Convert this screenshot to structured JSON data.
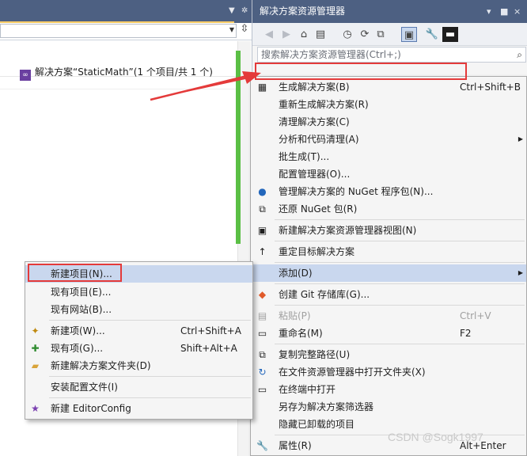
{
  "solution_explorer": {
    "title": "解决方案资源管理器",
    "title_controls": [
      "▾",
      "■",
      "×"
    ],
    "search_placeholder": "搜索解决方案资源管理器(Ctrl+;)",
    "root_node": "解决方案“StaticMath”(1 个项目/共 1 个)"
  },
  "context_menu": {
    "items": [
      {
        "label": "生成解决方案(B)",
        "shortcut": "Ctrl+Shift+B",
        "icon": "build-icon"
      },
      {
        "label": "重新生成解决方案(R)",
        "shortcut": ""
      },
      {
        "label": "清理解决方案(C)",
        "shortcut": ""
      },
      {
        "label": "分析和代码清理(A)",
        "shortcut": "",
        "submenu": true
      },
      {
        "label": "批生成(T)...",
        "shortcut": ""
      },
      {
        "label": "配置管理器(O)...",
        "shortcut": ""
      },
      {
        "label": "管理解决方案的 NuGet 程序包(N)...",
        "shortcut": "",
        "icon": "nuget-icon"
      },
      {
        "label": "还原 NuGet 包(R)",
        "shortcut": "",
        "icon": "restore-icon"
      },
      {
        "label": "新建解决方案资源管理器视图(N)",
        "shortcut": "",
        "icon": "new-view-icon"
      },
      {
        "label": "重定目标解决方案",
        "shortcut": "",
        "icon": "retarget-icon"
      },
      {
        "label": "添加(D)",
        "shortcut": "",
        "submenu": true
      },
      {
        "label": "创建 Git 存储库(G)...",
        "shortcut": "",
        "icon": "git-icon"
      },
      {
        "label": "粘贴(P)",
        "shortcut": "Ctrl+V",
        "icon": "paste-icon",
        "disabled": true
      },
      {
        "label": "重命名(M)",
        "shortcut": "F2",
        "icon": "rename-icon"
      },
      {
        "label": "复制完整路径(U)",
        "shortcut": "",
        "icon": "copy-icon"
      },
      {
        "label": "在文件资源管理器中打开文件夹(X)",
        "shortcut": "",
        "icon": "refresh-folder-icon"
      },
      {
        "label": "在终端中打开",
        "shortcut": "",
        "icon": "terminal-icon"
      },
      {
        "label": "另存为解决方案筛选器",
        "shortcut": ""
      },
      {
        "label": "隐藏已卸载的项目",
        "shortcut": ""
      },
      {
        "label": "属性(R)",
        "shortcut": "Alt+Enter",
        "icon": "wrench-icon"
      }
    ]
  },
  "add_submenu": {
    "items": [
      {
        "label": "新建项目(N)...",
        "shortcut": ""
      },
      {
        "label": "现有项目(E)...",
        "shortcut": ""
      },
      {
        "label": "现有网站(B)...",
        "shortcut": ""
      },
      {
        "label": "新建项(W)...",
        "shortcut": "Ctrl+Shift+A",
        "icon": "new-item-icon"
      },
      {
        "label": "现有项(G)...",
        "shortcut": "Shift+Alt+A",
        "icon": "existing-item-icon"
      },
      {
        "label": "新建解决方案文件夹(D)",
        "shortcut": "",
        "icon": "folder-icon"
      },
      {
        "label": "安装配置文件(I)",
        "shortcut": ""
      },
      {
        "label": "新建 EditorConfig",
        "shortcut": "",
        "icon": "editorconfig-icon"
      }
    ]
  },
  "watermark": "CSDN @Sogk1997",
  "colors": {
    "title_bar": "#4d6082",
    "menu_bg": "#f5f5f5",
    "highlight": "#c9d7ee",
    "annotation_red": "#e43a3a",
    "editor_change_bar": "#5bbf45"
  }
}
